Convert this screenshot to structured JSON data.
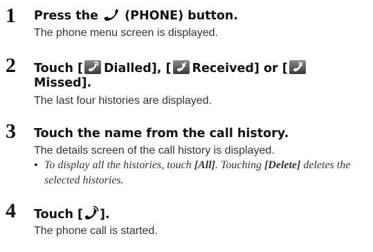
{
  "steps": [
    {
      "number": "1",
      "heading_pre": "Press the ",
      "heading_icon": "phone-handset-icon",
      "heading_post": " (PHONE) button.",
      "description": "The phone menu screen is displayed."
    },
    {
      "number": "2",
      "heading_touch": "Touch [",
      "tab_dialled": "Dialled",
      "heading_sep1": "], [",
      "tab_received": "Received",
      "heading_sep2": "] or [",
      "tab_missed": "Missed",
      "heading_end": "].",
      "icons": [
        "dialled-call-icon",
        "received-call-icon",
        "missed-call-icon"
      ],
      "description": "The last four histories are displayed."
    },
    {
      "number": "3",
      "heading": "Touch the name from the call history.",
      "description": "The details screen of the call history is displayed.",
      "note_bullet": "•",
      "note_1": "To display all the histories, touch ",
      "note_all": "[All]",
      "note_2": ". Touching ",
      "note_delete": "[Delete]",
      "note_3": " deletes the selected histories."
    },
    {
      "number": "4",
      "heading_pre": "Touch [",
      "heading_icon": "call-start-icon",
      "heading_post": "].",
      "description": "The phone call is started."
    }
  ]
}
